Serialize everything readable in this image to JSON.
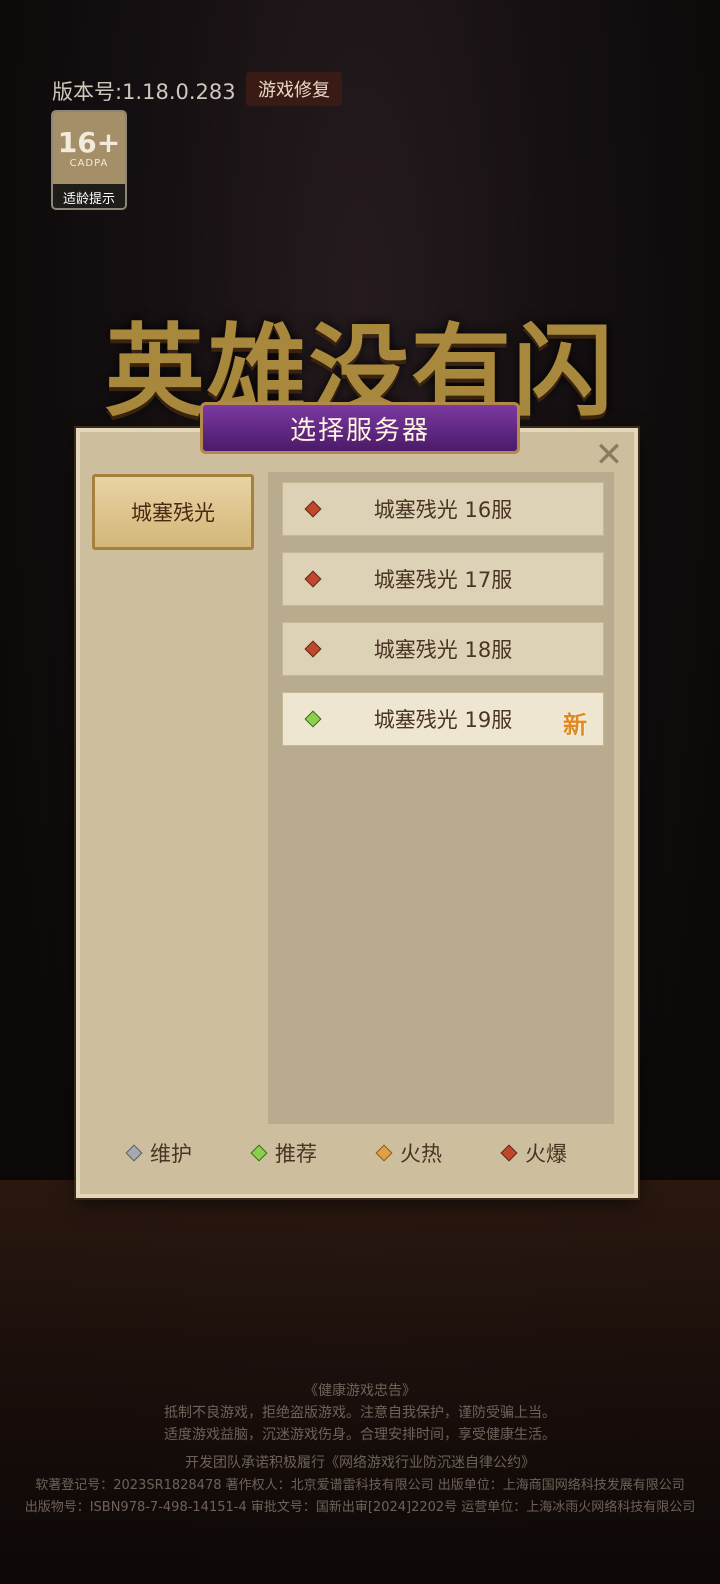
{
  "version_text": "版本号:1.18.0.283",
  "repair_button": "游戏修复",
  "age_badge": {
    "rating": "16+",
    "org": "CADPA",
    "label": "适龄提示"
  },
  "game_title": "英雄没有闪",
  "dialog": {
    "title": "选择服务器",
    "close": "✕",
    "tab": "城塞残光",
    "servers": [
      {
        "name": "城塞残光 16服",
        "status": "火爆",
        "color": "#c0462e",
        "new": ""
      },
      {
        "name": "城塞残光 17服",
        "status": "火爆",
        "color": "#c0462e",
        "new": ""
      },
      {
        "name": "城塞残光 18服",
        "status": "火爆",
        "color": "#c0462e",
        "new": ""
      },
      {
        "name": "城塞残光 19服",
        "status": "推荐",
        "color": "#8ccf4e",
        "new": "新"
      }
    ],
    "legend": [
      {
        "label": "维护",
        "color": "#a8a8b0"
      },
      {
        "label": "推荐",
        "color": "#8ccf4e"
      },
      {
        "label": "火热",
        "color": "#e0a048"
      },
      {
        "label": "火爆",
        "color": "#c0462e"
      }
    ]
  },
  "footer": {
    "line1": "《健康游戏忠告》",
    "line2": "抵制不良游戏，拒绝盗版游戏。注意自我保护，谨防受骗上当。",
    "line3": "适度游戏益脑，沉迷游戏伤身。合理安排时间，享受健康生活。",
    "line4": "开发团队承诺积极履行《网络游戏行业防沉迷自律公约》",
    "line5": "软著登记号：2023SR1828478 著作权人：北京爱谱雷科技有限公司 出版单位：上海商国网络科技发展有限公司",
    "line6": "出版物号：ISBN978-7-498-14151-4 审批文号：国新出审[2024]2202号 运营单位：上海冰雨火网络科技有限公司"
  }
}
